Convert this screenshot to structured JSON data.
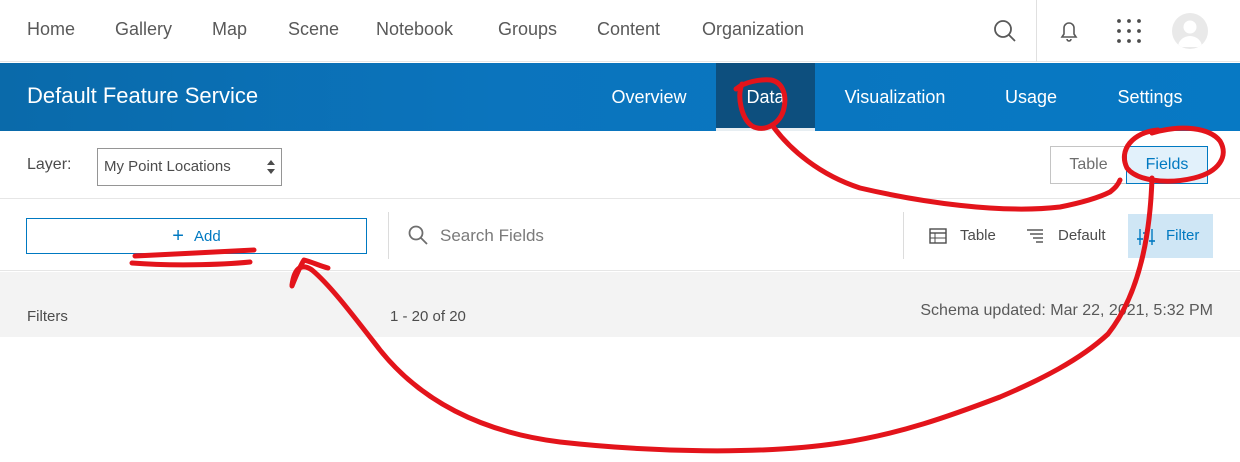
{
  "topnav": {
    "items": [
      "Home",
      "Gallery",
      "Map",
      "Scene",
      "Notebook",
      "Groups",
      "Content",
      "Organization"
    ],
    "icons": [
      "search-icon",
      "bell-icon",
      "app-launcher-icon",
      "avatar"
    ]
  },
  "header": {
    "title": "Default Feature Service",
    "tabs": [
      "Overview",
      "Data",
      "Visualization",
      "Usage",
      "Settings"
    ],
    "active_tab": "Data"
  },
  "layer_row": {
    "label": "Layer:",
    "selected_layer": "My Point Locations",
    "view_toggle": [
      "Table",
      "Fields"
    ],
    "active_view": "Fields"
  },
  "toolbar": {
    "add_label": "Add",
    "search_placeholder": "Search Fields",
    "table_label": "Table",
    "sort_label": "Default",
    "filter_label": "Filter"
  },
  "filters_bar": {
    "filters_label": "Filters",
    "count_text": "1 - 20 of 20",
    "schema_text": "Schema updated: Mar 22, 2021, 5:32 PM"
  },
  "colors": {
    "header_blue": "#0b74bd",
    "active_tab": "#0d4f7e",
    "accent": "#0079c1",
    "annotation_red": "#e3141b"
  }
}
